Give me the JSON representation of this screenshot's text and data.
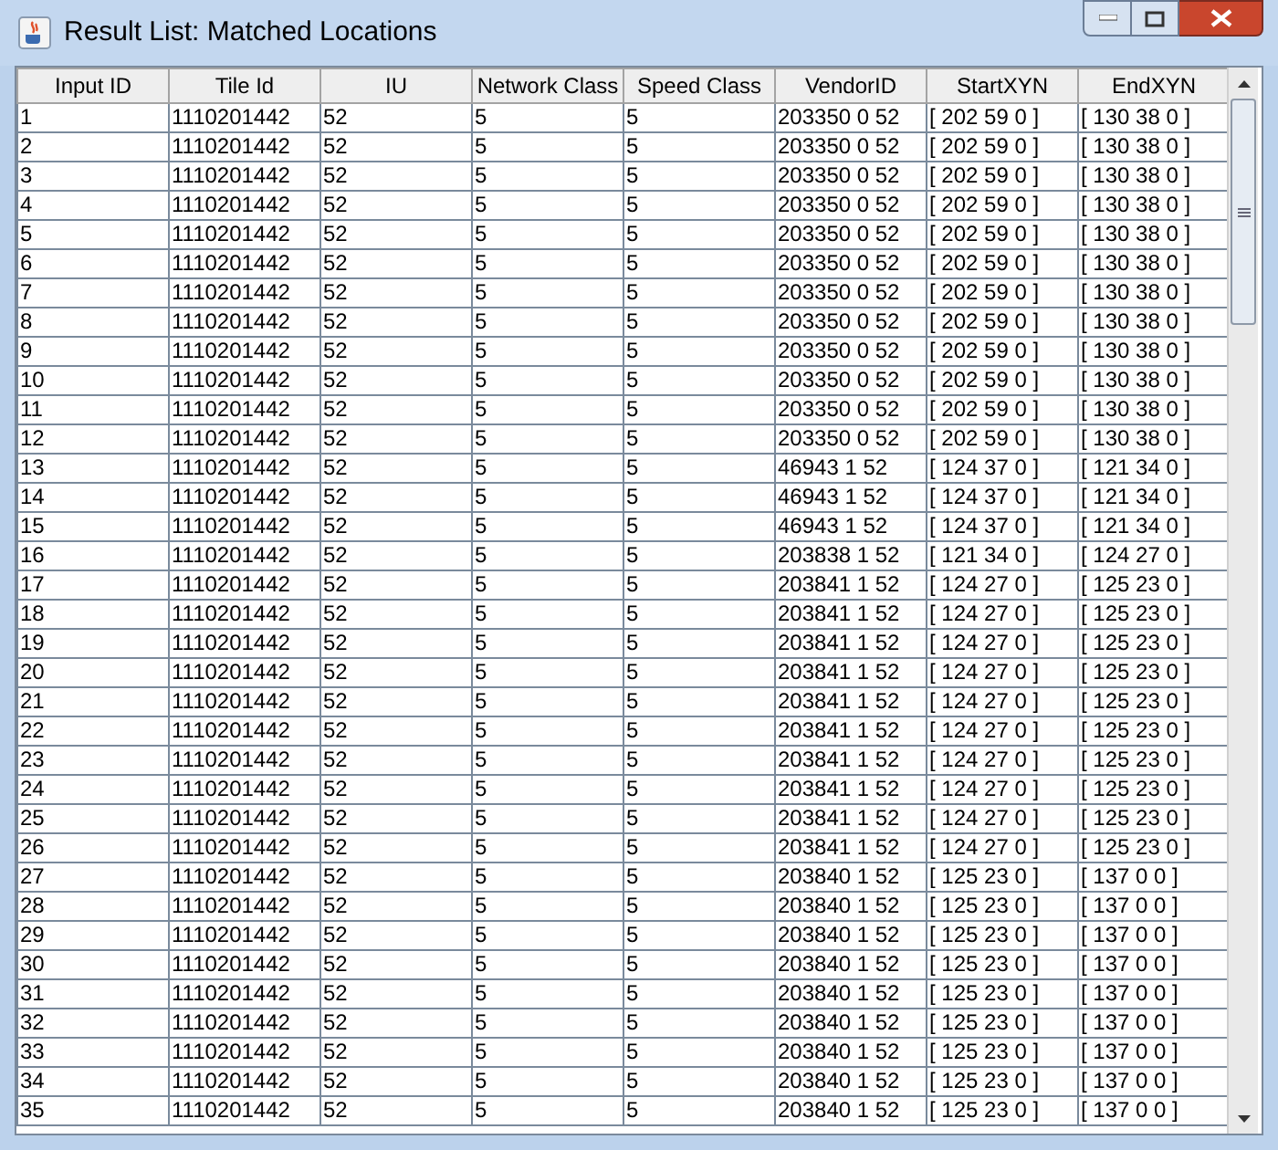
{
  "window": {
    "title": "Result List: Matched Locations"
  },
  "table": {
    "columns": [
      "Input ID",
      "Tile Id",
      "IU",
      "Network Class",
      "Speed Class",
      "VendorID",
      "StartXYN",
      "EndXYN"
    ],
    "rows": [
      [
        "1",
        "1110201442",
        "52",
        "5",
        "5",
        "203350 0 52",
        "[ 202 59 0 ]",
        "[ 130 38 0 ]"
      ],
      [
        "2",
        "1110201442",
        "52",
        "5",
        "5",
        "203350 0 52",
        "[ 202 59 0 ]",
        "[ 130 38 0 ]"
      ],
      [
        "3",
        "1110201442",
        "52",
        "5",
        "5",
        "203350 0 52",
        "[ 202 59 0 ]",
        "[ 130 38 0 ]"
      ],
      [
        "4",
        "1110201442",
        "52",
        "5",
        "5",
        "203350 0 52",
        "[ 202 59 0 ]",
        "[ 130 38 0 ]"
      ],
      [
        "5",
        "1110201442",
        "52",
        "5",
        "5",
        "203350 0 52",
        "[ 202 59 0 ]",
        "[ 130 38 0 ]"
      ],
      [
        "6",
        "1110201442",
        "52",
        "5",
        "5",
        "203350 0 52",
        "[ 202 59 0 ]",
        "[ 130 38 0 ]"
      ],
      [
        "7",
        "1110201442",
        "52",
        "5",
        "5",
        "203350 0 52",
        "[ 202 59 0 ]",
        "[ 130 38 0 ]"
      ],
      [
        "8",
        "1110201442",
        "52",
        "5",
        "5",
        "203350 0 52",
        "[ 202 59 0 ]",
        "[ 130 38 0 ]"
      ],
      [
        "9",
        "1110201442",
        "52",
        "5",
        "5",
        "203350 0 52",
        "[ 202 59 0 ]",
        "[ 130 38 0 ]"
      ],
      [
        "10",
        "1110201442",
        "52",
        "5",
        "5",
        "203350 0 52",
        "[ 202 59 0 ]",
        "[ 130 38 0 ]"
      ],
      [
        "11",
        "1110201442",
        "52",
        "5",
        "5",
        "203350 0 52",
        "[ 202 59 0 ]",
        "[ 130 38 0 ]"
      ],
      [
        "12",
        "1110201442",
        "52",
        "5",
        "5",
        "203350 0 52",
        "[ 202 59 0 ]",
        "[ 130 38 0 ]"
      ],
      [
        "13",
        "1110201442",
        "52",
        "5",
        "5",
        "46943 1 52",
        "[ 124 37 0 ]",
        "[ 121 34 0 ]"
      ],
      [
        "14",
        "1110201442",
        "52",
        "5",
        "5",
        "46943 1 52",
        "[ 124 37 0 ]",
        "[ 121 34 0 ]"
      ],
      [
        "15",
        "1110201442",
        "52",
        "5",
        "5",
        "46943 1 52",
        "[ 124 37 0 ]",
        "[ 121 34 0 ]"
      ],
      [
        "16",
        "1110201442",
        "52",
        "5",
        "5",
        "203838 1 52",
        "[ 121 34 0 ]",
        "[ 124 27 0 ]"
      ],
      [
        "17",
        "1110201442",
        "52",
        "5",
        "5",
        "203841 1 52",
        "[ 124 27 0 ]",
        "[ 125 23 0 ]"
      ],
      [
        "18",
        "1110201442",
        "52",
        "5",
        "5",
        "203841 1 52",
        "[ 124 27 0 ]",
        "[ 125 23 0 ]"
      ],
      [
        "19",
        "1110201442",
        "52",
        "5",
        "5",
        "203841 1 52",
        "[ 124 27 0 ]",
        "[ 125 23 0 ]"
      ],
      [
        "20",
        "1110201442",
        "52",
        "5",
        "5",
        "203841 1 52",
        "[ 124 27 0 ]",
        "[ 125 23 0 ]"
      ],
      [
        "21",
        "1110201442",
        "52",
        "5",
        "5",
        "203841 1 52",
        "[ 124 27 0 ]",
        "[ 125 23 0 ]"
      ],
      [
        "22",
        "1110201442",
        "52",
        "5",
        "5",
        "203841 1 52",
        "[ 124 27 0 ]",
        "[ 125 23 0 ]"
      ],
      [
        "23",
        "1110201442",
        "52",
        "5",
        "5",
        "203841 1 52",
        "[ 124 27 0 ]",
        "[ 125 23 0 ]"
      ],
      [
        "24",
        "1110201442",
        "52",
        "5",
        "5",
        "203841 1 52",
        "[ 124 27 0 ]",
        "[ 125 23 0 ]"
      ],
      [
        "25",
        "1110201442",
        "52",
        "5",
        "5",
        "203841 1 52",
        "[ 124 27 0 ]",
        "[ 125 23 0 ]"
      ],
      [
        "26",
        "1110201442",
        "52",
        "5",
        "5",
        "203841 1 52",
        "[ 124 27 0 ]",
        "[ 125 23 0 ]"
      ],
      [
        "27",
        "1110201442",
        "52",
        "5",
        "5",
        "203840 1 52",
        "[ 125 23 0 ]",
        "[ 137 0 0 ]"
      ],
      [
        "28",
        "1110201442",
        "52",
        "5",
        "5",
        "203840 1 52",
        "[ 125 23 0 ]",
        "[ 137 0 0 ]"
      ],
      [
        "29",
        "1110201442",
        "52",
        "5",
        "5",
        "203840 1 52",
        "[ 125 23 0 ]",
        "[ 137 0 0 ]"
      ],
      [
        "30",
        "1110201442",
        "52",
        "5",
        "5",
        "203840 1 52",
        "[ 125 23 0 ]",
        "[ 137 0 0 ]"
      ],
      [
        "31",
        "1110201442",
        "52",
        "5",
        "5",
        "203840 1 52",
        "[ 125 23 0 ]",
        "[ 137 0 0 ]"
      ],
      [
        "32",
        "1110201442",
        "52",
        "5",
        "5",
        "203840 1 52",
        "[ 125 23 0 ]",
        "[ 137 0 0 ]"
      ],
      [
        "33",
        "1110201442",
        "52",
        "5",
        "5",
        "203840 1 52",
        "[ 125 23 0 ]",
        "[ 137 0 0 ]"
      ],
      [
        "34",
        "1110201442",
        "52",
        "5",
        "5",
        "203840 1 52",
        "[ 125 23 0 ]",
        "[ 137 0 0 ]"
      ],
      [
        "35",
        "1110201442",
        "52",
        "5",
        "5",
        "203840 1 52",
        "[ 125 23 0 ]",
        "[ 137 0 0 ]"
      ]
    ]
  }
}
